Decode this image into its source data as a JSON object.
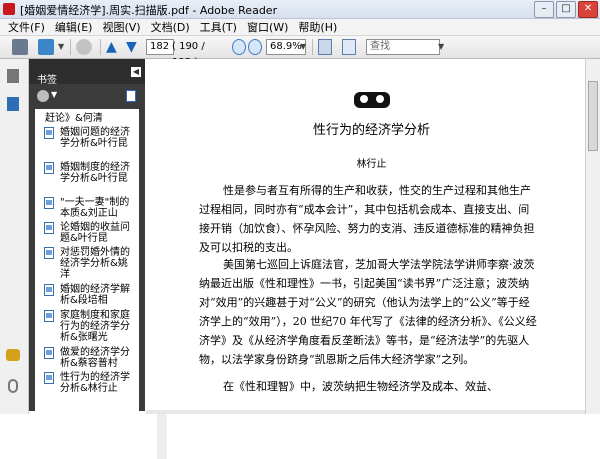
{
  "window": {
    "title": "[婚姻爱情经济学].周实.扫描版.pdf - Adobe Reader"
  },
  "menu": [
    "文件(F)",
    "编辑(E)",
    "视图(V)",
    "文档(D)",
    "工具(T)",
    "窗口(W)",
    "帮助(H)"
  ],
  "toolbar": {
    "page_value": "182",
    "page_total": "( 190 / 193 )",
    "zoom": "68.9%",
    "search_placeholder": "查找"
  },
  "panel": {
    "title": "书签"
  },
  "bookmarks": [
    "赶论》&何清",
    "婚姻问题的经济学分析&叶行昆",
    "婚姻制度的经济学分析&叶行昆",
    "\"一夫一妻\"制的本质&刘正山",
    "论婚姻的收益问题&叶行昆",
    "对惩罚婚外情的经济学分析&姚洋",
    "婚姻的经济学解析&段培相",
    "家庭制度和家庭行为的经济学分析&张曙光",
    "做爱的经济学分析&蔡容普村",
    "性行为的经济学分析&林行止"
  ],
  "page": {
    "title": "性行为的经济学分析",
    "author": "林行止",
    "paragraphs": [
      "性是参与者互有所得的生产和收获，性交的生产过程和其他生产过程相同，同时亦有“成本会计”，其中包括机会成本、直接支出、间接开销（加饮食）、怀孕风险、努力的支消、违反道德标准的精神负担及可以扣税的支出。",
      "美国第七巡回上诉庭法官，芝加哥大学法学院法学讲师李察·波茨纳最近出版《性和理性》一书，引起美国“读书界”广泛注意；波茨纳对“效用”的兴趣甚于对“公义”的研究（他认为法学上的“公义”等于经济学上的“效用”），20 世纪70 年代写了《法律的经济分析》、《公义经济学》及《从经济学角度看反垄断法》等书，是“经济法学”的先驱人物，以法学家身份跻身“凯恩斯之后伟大经济学家”之列。",
      "在《性和理智》中，波茨纳把生物经济学及成本、效益、"
    ]
  }
}
